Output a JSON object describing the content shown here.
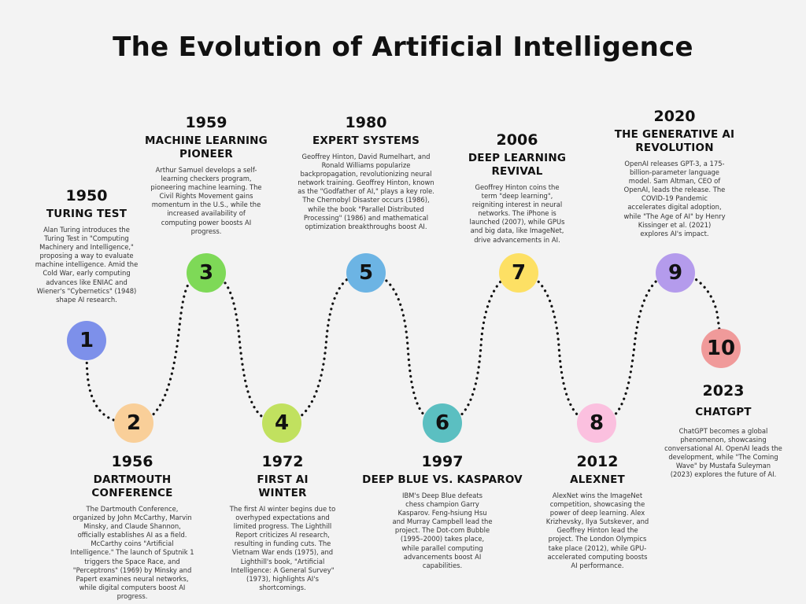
{
  "title": "The Evolution of Artificial Intelligence",
  "milestones": [
    {
      "number": "1",
      "year": "1950",
      "heading": "TURING TEST",
      "color": "#7d90ea",
      "description": "Alan Turing introduces the Turing Test in \"Computing Machinery and Intelligence,\" proposing a way to evaluate machine intelligence. Amid the Cold War, early computing advances like ENIAC and Wiener's \"Cybernetics\" (1948) shape AI research."
    },
    {
      "number": "2",
      "year": "1956",
      "heading": "DARTMOUTH CONFERENCE",
      "color": "#f9cf99",
      "description": "The Dartmouth Conference, organized by John McCarthy, Marvin Minsky, and Claude Shannon, officially establishes AI as a field. McCarthy coins \"Artificial Intelligence.\" The launch of Sputnik 1 triggers the Space Race, and \"Perceptrons\" (1969) by Minsky and Papert examines neural networks, while digital computers boost AI progress."
    },
    {
      "number": "3",
      "year": "1959",
      "heading": "MACHINE LEARNING PIONEER",
      "color": "#7ed957",
      "description": "Arthur Samuel develops a self-learning checkers program, pioneering machine learning. The Civil Rights Movement gains momentum in the U.S., while the increased availability of computing power boosts AI progress."
    },
    {
      "number": "4",
      "year": "1972",
      "heading": "FIRST AI WINTER",
      "color": "#c1e15f",
      "description": "The first AI winter begins due to overhyped expectations and limited progress. The Lighthill Report criticizes AI research, resulting in funding cuts. The Vietnam War ends (1975), and Lighthill's book, \"Artificial Intelligence: A General Survey\" (1973), highlights AI's shortcomings."
    },
    {
      "number": "5",
      "year": "1980",
      "heading": "EXPERT SYSTEMS",
      "color": "#6cb4e4",
      "description": "Geoffrey Hinton, David Rumelhart, and Ronald Williams popularize backpropagation, revolutionizing neural network training. Geoffrey Hinton, known as the \"Godfather of AI,\" plays a key role. The Chernobyl Disaster occurs (1986), while the book \"Parallel Distributed Processing\" (1986) and mathematical optimization breakthroughs boost AI."
    },
    {
      "number": "6",
      "year": "1997",
      "heading": "DEEP BLUE VS. KASPAROV",
      "color": "#5bbfc1",
      "description": "IBM's Deep Blue defeats chess champion Garry Kasparov. Feng-hsiung Hsu and Murray Campbell lead the project. The Dot-com Bubble (1995–2000) takes place, while parallel computing advancements boost AI capabilities."
    },
    {
      "number": "7",
      "year": "2006",
      "heading": "DEEP LEARNING REVIVAL",
      "color": "#fde064",
      "description": "Geoffrey Hinton coins the term \"deep learning\", reigniting interest in neural networks. The iPhone is launched (2007), while GPUs and big data, like ImageNet, drive advancements in AI."
    },
    {
      "number": "8",
      "year": "2012",
      "heading": "ALEXNET",
      "color": "#fbc0df",
      "description": "AlexNet wins the ImageNet competition, showcasing the power of deep learning. Alex Krizhevsky, Ilya Sutskever, and Geoffrey Hinton lead the project. The London Olympics take place (2012), while GPU-accelerated computing boosts AI performance."
    },
    {
      "number": "9",
      "year": "2020",
      "heading": "THE GENERATIVE AI REVOLUTION",
      "color": "#b49bec",
      "description": "OpenAI releases GPT-3, a 175-billion-parameter language model. Sam Altman, CEO of OpenAI, leads the release. The COVID-19 Pandemic accelerates digital adoption, while \"The Age of AI\" by Henry Kissinger et al. (2021) explores AI's impact."
    },
    {
      "number": "10",
      "year": "2023",
      "heading": "CHATGPT",
      "color": "#f09a9a",
      "description": "ChatGPT becomes a global phenomenon, showcasing conversational AI. OpenAI leads the development, while \"The Coming Wave\" by Mustafa Suleyman (2023) explores the future of AI."
    }
  ]
}
